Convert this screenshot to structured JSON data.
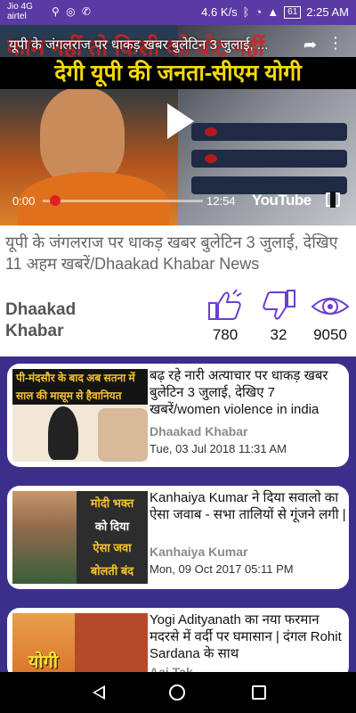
{
  "status_bar": {
    "carrier_top": "Jio 4G",
    "carrier_bottom": "airtel",
    "speed": "4.6 K/s",
    "battery": "61",
    "time": "2:25 AM"
  },
  "video": {
    "banner_top": "काम नहीं तो किसी को वोट नहीं",
    "banner_bottom": "देगी यूपी की जनता-सीएम योगी",
    "title": "यूपी के जंगलराज पर धाकड़ खबर बुलेटिन 3  जुलाई, ...",
    "time_current": "0:00",
    "time_total": "12:54",
    "progress": 0.0,
    "brand": "YouTube"
  },
  "main": {
    "title": "यूपी के जंगलराज पर धाकड़ खबर बुलेटिन 3  जुलाई, देखिए 11 अहम खबरें/Dhaakad Khabar News",
    "channel": "Dhaakad Khabar",
    "likes": "780",
    "dislikes": "32",
    "views": "9050",
    "icon_color": "#6a3fd0"
  },
  "related": [
    {
      "title": "बढ़ रहे नारी अत्याचार पर धाकड़ खबर बुलेटिन 3 जुलाई, देखिए 7 खबरें/women violence in india",
      "channel": "Dhaakad Khabar",
      "date": "Tue, 03 Jul 2018 11:31 AM",
      "thumb_text": "पी-मंदसौर के बाद अब सतना में साल की मासूम से हैवानियत"
    },
    {
      "title": "Kanhaiya Kumar ने दिया सवालो का ऐसा जवाब - सभा तालियों से गूंजने लगी |",
      "channel": "Kanhaiya Kumar",
      "date": "Mon, 09 Oct 2017 05:11 PM",
      "thumb_text_1": "मोदी भक्त",
      "thumb_text_2": "को दिया",
      "thumb_text_3": "ऐसा जवा",
      "thumb_text_4": "बोलती बंद"
    },
    {
      "title": "Yogi Adityanath का नया फरमान मदरसे में वर्दी पर घमासान | दंगल Rohit Sardana के साथ",
      "channel": "Aaj Tak",
      "thumb_text": "योगी"
    }
  ]
}
